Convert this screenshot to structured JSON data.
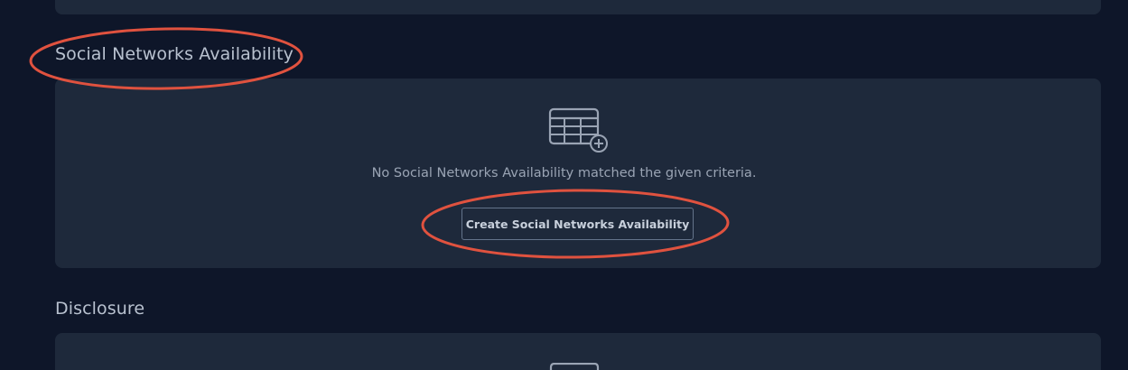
{
  "sections": {
    "social": {
      "heading": "Social Networks Availability",
      "empty_icon": "table-add-icon",
      "empty_message": "No Social Networks Availability matched the given criteria.",
      "create_button_label": "Create Social Networks Availability"
    },
    "disclosure": {
      "heading": "Disclosure",
      "empty_icon": "table-add-icon"
    }
  },
  "annotations": {
    "color": "#e0523f",
    "shape": "ellipse-outline",
    "targets": [
      "social-networks-heading",
      "create-social-networks-button"
    ]
  },
  "colors": {
    "background": "#0e1629",
    "panel": "#1e293b",
    "heading_text": "#b8c1cf",
    "muted_text": "#9aa4b4",
    "button_border": "#64748b"
  }
}
